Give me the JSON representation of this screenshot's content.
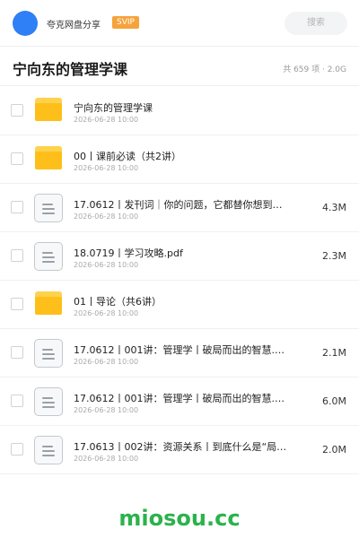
{
  "header": {
    "brand": "夸克网盘分享",
    "badge": "SVIP",
    "search_placeholder": "搜索"
  },
  "folder": {
    "title": "宁向东的管理学课",
    "meta": "共 659 项 · 2.0G"
  },
  "items": [
    {
      "type": "folder",
      "name": "宁向东的管理学课",
      "date": "2026-06-28 10:00",
      "size": ""
    },
    {
      "type": "folder",
      "name": "00丨课前必读（共2讲）",
      "date": "2026-06-28 10:00",
      "size": ""
    },
    {
      "type": "file",
      "name": "17.0612丨发刊词｜你的问题，它都替你想到了.…",
      "date": "2026-06-28 10:00",
      "size": "4.3M"
    },
    {
      "type": "file",
      "name": "18.0719丨学习攻略.pdf",
      "date": "2026-06-28 10:00",
      "size": "2.3M"
    },
    {
      "type": "folder",
      "name": "01丨导论（共6讲）",
      "date": "2026-06-28 10:00",
      "size": ""
    },
    {
      "type": "file",
      "name": "17.0612丨001讲：管理学丨破局而出的智慧.…",
      "date": "2026-06-28 10:00",
      "size": "2.1M"
    },
    {
      "type": "file",
      "name": "17.0612丨001讲：管理学丨破局而出的智慧.…",
      "date": "2026-06-28 10:00",
      "size": "6.0M"
    },
    {
      "type": "file",
      "name": "17.0613丨002讲：资源关系丨到底什么是“局…",
      "date": "2026-06-28 10:00",
      "size": "2.0M"
    }
  ],
  "watermark": "miosou.cc",
  "colors": {
    "accent": "#2f7ff6",
    "badge": "#f6a33b",
    "folder": "#ffbf1a",
    "watermark": "#2bb24c"
  }
}
